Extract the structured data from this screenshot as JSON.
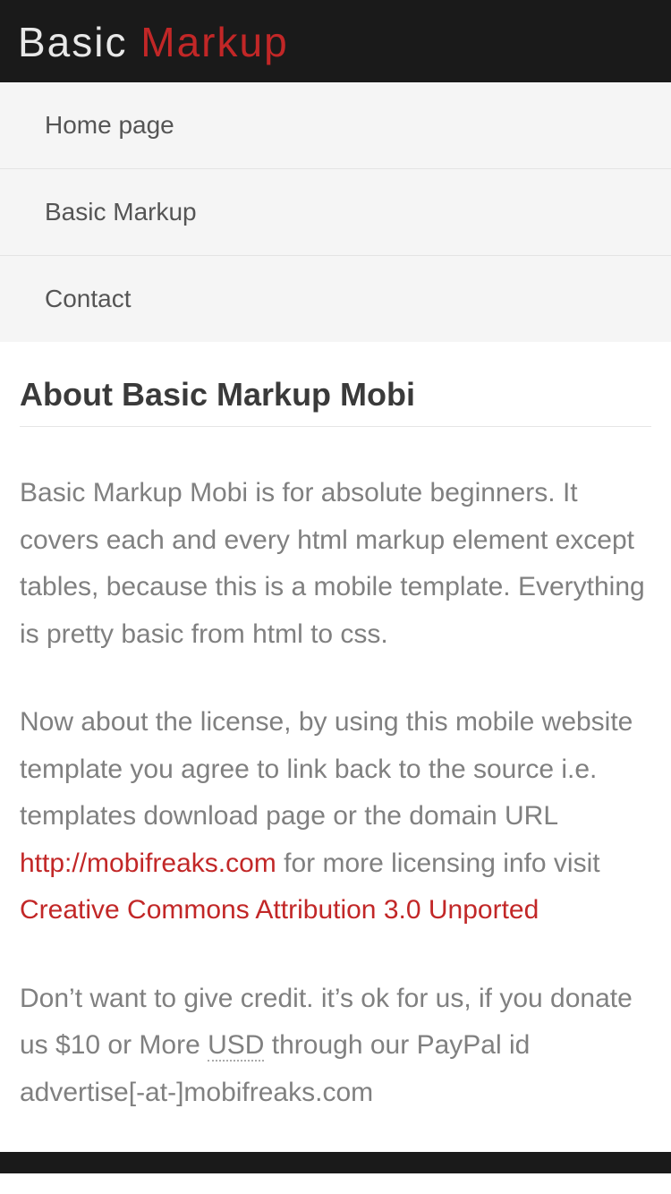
{
  "header": {
    "logo_word1": "Basic",
    "logo_word2": "Markup"
  },
  "nav": {
    "items": [
      {
        "label": "Home page"
      },
      {
        "label": "Basic Markup"
      },
      {
        "label": "Contact"
      }
    ]
  },
  "content": {
    "title": "About Basic Markup Mobi",
    "p1": "Basic Markup Mobi is for absolute beginners. It covers each and every html markup element except tables, because this is a mobile template. Everything is pretty basic from html to css.",
    "p2_a": "Now about the license, by using this mobile website template you agree to link back to the source i.e. templates download page or the domain URL ",
    "p2_link1": "http://mobifreaks.com",
    "p2_b": " for more licensing info visit ",
    "p2_link2": "Creative Commons Attribution 3.0 Unported",
    "p3_a": "Don’t want to give credit. it’s ok for us, if you donate us $10 or More ",
    "p3_abbr": "USD",
    "p3_b": " through our PayPal id advertise[-at-]mobifreaks.com"
  }
}
